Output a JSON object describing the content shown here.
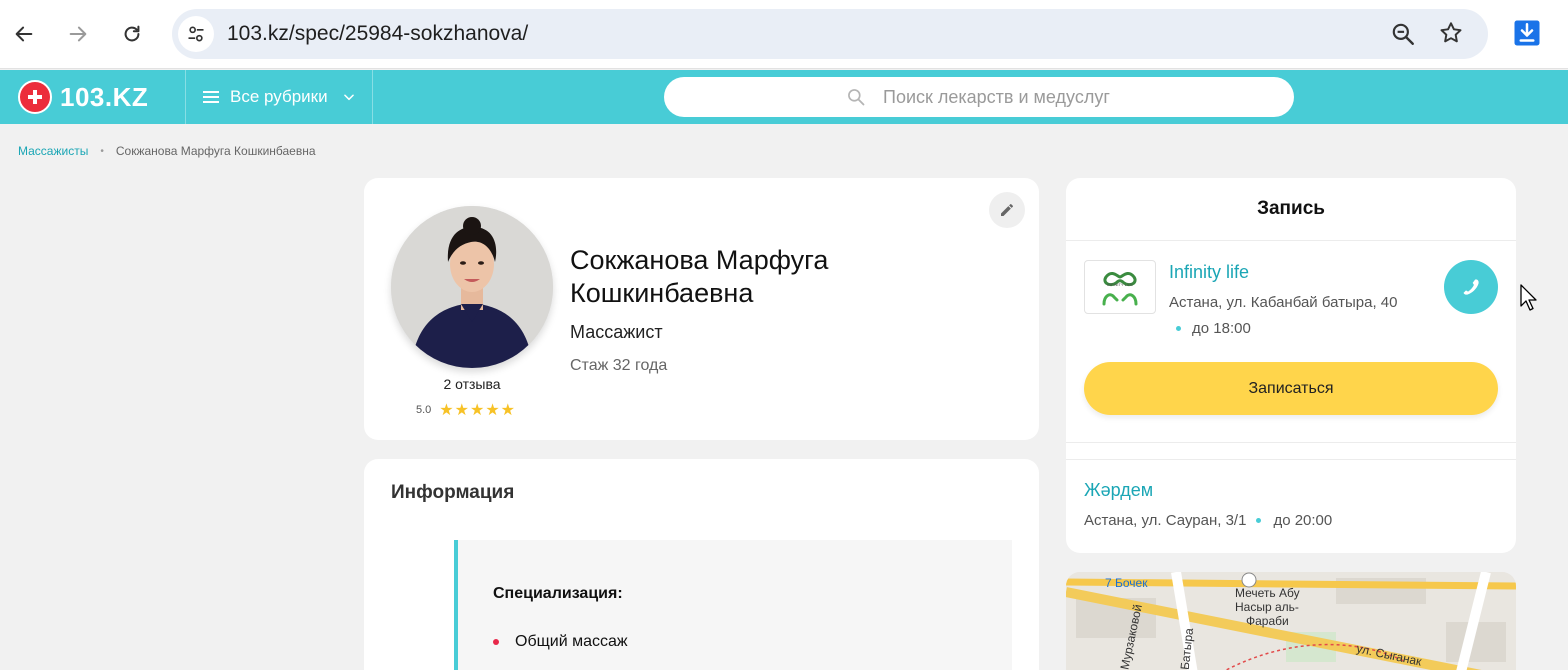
{
  "browser": {
    "url": "103.kz/spec/25984-sokzhanova/"
  },
  "header": {
    "logo_text": "103.KZ",
    "rubrics_label": "Все рубрики",
    "search_placeholder": "Поиск лекарств и медуслуг"
  },
  "breadcrumb": {
    "parent": "Массажисты",
    "separator": "•",
    "current": "Сокжанова Марфуга Кошкинбаевна"
  },
  "profile": {
    "name": "Сокжанова Марфуга Кошкинбаевна",
    "role": "Массажист",
    "experience": "Стаж 32 года",
    "reviews": "2 отзыва",
    "rating": "5.0",
    "stars": "★★★★★"
  },
  "info": {
    "title": "Информация",
    "specialization_label": "Специализация:",
    "specialization_items": [
      "Общий массаж"
    ]
  },
  "booking": {
    "title": "Запись",
    "clinic": {
      "name": "Infinity life",
      "address": "Астана, ул. Кабанбай батыра, 40",
      "hours": "до 18:00",
      "logo_text": "INFINITY LIFE"
    },
    "button_label": "Записаться",
    "alt_clinic": {
      "name": "Жәрдем",
      "address": "Астана, ул. Сауран, 3/1",
      "hours": "до 20:00"
    }
  },
  "map": {
    "labels": [
      "7 Бочек",
      "Мечеть Абу",
      "Насыр аль-",
      "Фараби",
      "ул. Сыганак",
      "Мурзаковой",
      "Батыра"
    ]
  },
  "colors": {
    "accent": "#48ccd6",
    "link": "#1ba6b5",
    "button": "#ffd54b",
    "logo_red": "#ec2d3b",
    "star": "#f7c227"
  }
}
